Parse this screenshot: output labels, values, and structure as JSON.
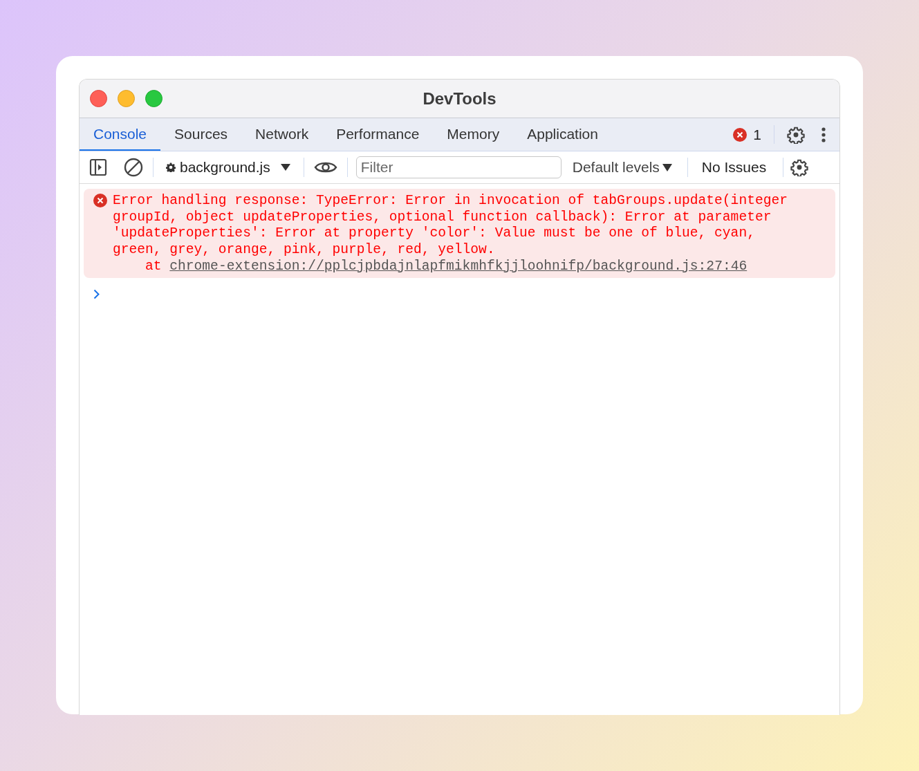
{
  "window": {
    "title": "DevTools"
  },
  "tabs": [
    {
      "label": "Console",
      "selected": true
    },
    {
      "label": "Sources",
      "selected": false
    },
    {
      "label": "Network",
      "selected": false
    },
    {
      "label": "Performance",
      "selected": false
    },
    {
      "label": "Memory",
      "selected": false
    },
    {
      "label": "Application",
      "selected": false
    }
  ],
  "error_count": "1",
  "toolbar": {
    "context": "background.js",
    "filter": {
      "placeholder": "Filter"
    },
    "levels": "Default levels",
    "issues": "No Issues"
  },
  "console": {
    "messages": [
      {
        "kind": "error",
        "text": "Error handling response: TypeError: Error in invocation of tabGroups.update(integer groupId, object updateProperties, optional function callback): Error at parameter 'updateProperties': Error at property 'color': Value must be one of blue, cyan, green, grey, orange, pink, purple, red, yellow.",
        "at": "at",
        "link": "chrome-extension://pplcjpbdajnlapfmikmhfkjjloohnifp/background.js:27:46"
      }
    ]
  }
}
